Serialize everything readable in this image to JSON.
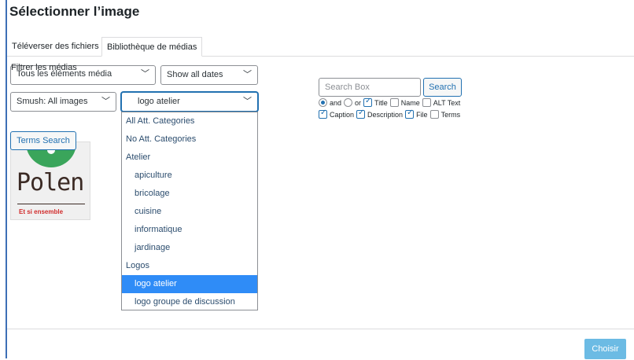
{
  "modal": {
    "title": "Sélectionner l’image"
  },
  "tabs": [
    {
      "label": "Téléverser des fichiers"
    },
    {
      "label": "Bibliothèque de médias"
    }
  ],
  "filters": {
    "label": "Filtrer les médias",
    "media_type": "Tous les éléments média",
    "dates": "Show all dates",
    "smush": "Smush: All images",
    "category": "logo atelier"
  },
  "category_options": [
    {
      "label": "All Att. Categories"
    },
    {
      "label": "No Att. Categories"
    },
    {
      "label": "Atelier"
    },
    {
      "label": "apiculture"
    },
    {
      "label": "bricolage"
    },
    {
      "label": "cuisine"
    },
    {
      "label": "informatique"
    },
    {
      "label": "jardinage"
    },
    {
      "label": "Logos"
    },
    {
      "label": "logo atelier"
    },
    {
      "label": "logo groupe de discussion"
    }
  ],
  "terms_search": {
    "label": "Terms Search"
  },
  "thumbnail": {
    "logo_text": "Polen",
    "tagline": "Et si ensemble",
    "brand_color": "#3aa55b"
  },
  "search": {
    "placeholder": "Search Box",
    "button": "Search",
    "and_label": "and",
    "or_label": "or",
    "title_label": "Title",
    "name_label": "Name",
    "alt_label": "ALT Text",
    "caption_label": "Caption",
    "description_label": "Description",
    "file_label": "File",
    "terms_label": "Terms"
  },
  "footer": {
    "choose_label": "Choisir"
  },
  "colors": {
    "accent": "#2271b1",
    "selected_option": "#2f8cf7",
    "choose_button": "#2e9fd9"
  }
}
